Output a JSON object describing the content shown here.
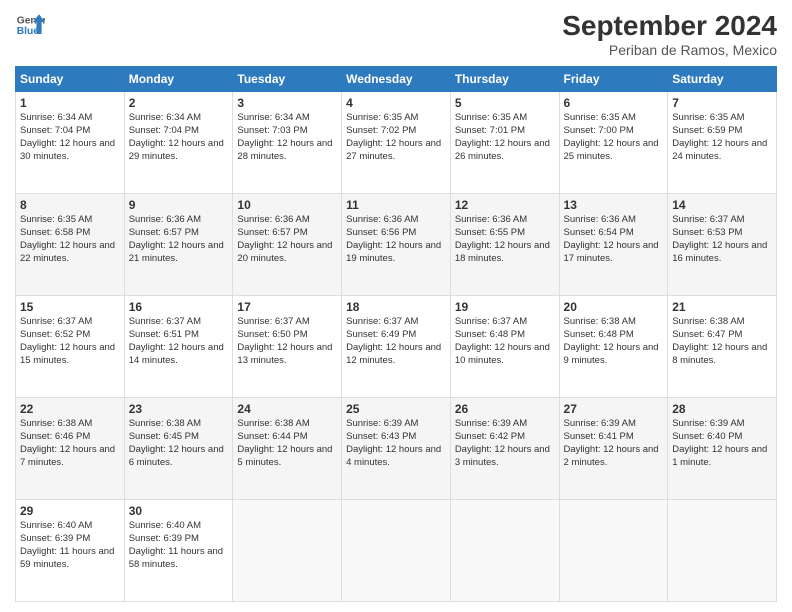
{
  "header": {
    "logo_line1": "General",
    "logo_line2": "Blue",
    "month": "September 2024",
    "location": "Periban de Ramos, Mexico"
  },
  "days_of_week": [
    "Sunday",
    "Monday",
    "Tuesday",
    "Wednesday",
    "Thursday",
    "Friday",
    "Saturday"
  ],
  "weeks": [
    [
      {
        "day": "1",
        "sunrise": "6:34 AM",
        "sunset": "7:04 PM",
        "daylight": "12 hours and 30 minutes."
      },
      {
        "day": "2",
        "sunrise": "6:34 AM",
        "sunset": "7:04 PM",
        "daylight": "12 hours and 29 minutes."
      },
      {
        "day": "3",
        "sunrise": "6:34 AM",
        "sunset": "7:03 PM",
        "daylight": "12 hours and 28 minutes."
      },
      {
        "day": "4",
        "sunrise": "6:35 AM",
        "sunset": "7:02 PM",
        "daylight": "12 hours and 27 minutes."
      },
      {
        "day": "5",
        "sunrise": "6:35 AM",
        "sunset": "7:01 PM",
        "daylight": "12 hours and 26 minutes."
      },
      {
        "day": "6",
        "sunrise": "6:35 AM",
        "sunset": "7:00 PM",
        "daylight": "12 hours and 25 minutes."
      },
      {
        "day": "7",
        "sunrise": "6:35 AM",
        "sunset": "6:59 PM",
        "daylight": "12 hours and 24 minutes."
      }
    ],
    [
      {
        "day": "8",
        "sunrise": "6:35 AM",
        "sunset": "6:58 PM",
        "daylight": "12 hours and 22 minutes."
      },
      {
        "day": "9",
        "sunrise": "6:36 AM",
        "sunset": "6:57 PM",
        "daylight": "12 hours and 21 minutes."
      },
      {
        "day": "10",
        "sunrise": "6:36 AM",
        "sunset": "6:57 PM",
        "daylight": "12 hours and 20 minutes."
      },
      {
        "day": "11",
        "sunrise": "6:36 AM",
        "sunset": "6:56 PM",
        "daylight": "12 hours and 19 minutes."
      },
      {
        "day": "12",
        "sunrise": "6:36 AM",
        "sunset": "6:55 PM",
        "daylight": "12 hours and 18 minutes."
      },
      {
        "day": "13",
        "sunrise": "6:36 AM",
        "sunset": "6:54 PM",
        "daylight": "12 hours and 17 minutes."
      },
      {
        "day": "14",
        "sunrise": "6:37 AM",
        "sunset": "6:53 PM",
        "daylight": "12 hours and 16 minutes."
      }
    ],
    [
      {
        "day": "15",
        "sunrise": "6:37 AM",
        "sunset": "6:52 PM",
        "daylight": "12 hours and 15 minutes."
      },
      {
        "day": "16",
        "sunrise": "6:37 AM",
        "sunset": "6:51 PM",
        "daylight": "12 hours and 14 minutes."
      },
      {
        "day": "17",
        "sunrise": "6:37 AM",
        "sunset": "6:50 PM",
        "daylight": "12 hours and 13 minutes."
      },
      {
        "day": "18",
        "sunrise": "6:37 AM",
        "sunset": "6:49 PM",
        "daylight": "12 hours and 12 minutes."
      },
      {
        "day": "19",
        "sunrise": "6:37 AM",
        "sunset": "6:48 PM",
        "daylight": "12 hours and 10 minutes."
      },
      {
        "day": "20",
        "sunrise": "6:38 AM",
        "sunset": "6:48 PM",
        "daylight": "12 hours and 9 minutes."
      },
      {
        "day": "21",
        "sunrise": "6:38 AM",
        "sunset": "6:47 PM",
        "daylight": "12 hours and 8 minutes."
      }
    ],
    [
      {
        "day": "22",
        "sunrise": "6:38 AM",
        "sunset": "6:46 PM",
        "daylight": "12 hours and 7 minutes."
      },
      {
        "day": "23",
        "sunrise": "6:38 AM",
        "sunset": "6:45 PM",
        "daylight": "12 hours and 6 minutes."
      },
      {
        "day": "24",
        "sunrise": "6:38 AM",
        "sunset": "6:44 PM",
        "daylight": "12 hours and 5 minutes."
      },
      {
        "day": "25",
        "sunrise": "6:39 AM",
        "sunset": "6:43 PM",
        "daylight": "12 hours and 4 minutes."
      },
      {
        "day": "26",
        "sunrise": "6:39 AM",
        "sunset": "6:42 PM",
        "daylight": "12 hours and 3 minutes."
      },
      {
        "day": "27",
        "sunrise": "6:39 AM",
        "sunset": "6:41 PM",
        "daylight": "12 hours and 2 minutes."
      },
      {
        "day": "28",
        "sunrise": "6:39 AM",
        "sunset": "6:40 PM",
        "daylight": "12 hours and 1 minute."
      }
    ],
    [
      {
        "day": "29",
        "sunrise": "6:40 AM",
        "sunset": "6:39 PM",
        "daylight": "11 hours and 59 minutes."
      },
      {
        "day": "30",
        "sunrise": "6:40 AM",
        "sunset": "6:39 PM",
        "daylight": "11 hours and 58 minutes."
      },
      {
        "day": "",
        "sunrise": "",
        "sunset": "",
        "daylight": ""
      },
      {
        "day": "",
        "sunrise": "",
        "sunset": "",
        "daylight": ""
      },
      {
        "day": "",
        "sunrise": "",
        "sunset": "",
        "daylight": ""
      },
      {
        "day": "",
        "sunrise": "",
        "sunset": "",
        "daylight": ""
      },
      {
        "day": "",
        "sunrise": "",
        "sunset": "",
        "daylight": ""
      }
    ]
  ]
}
